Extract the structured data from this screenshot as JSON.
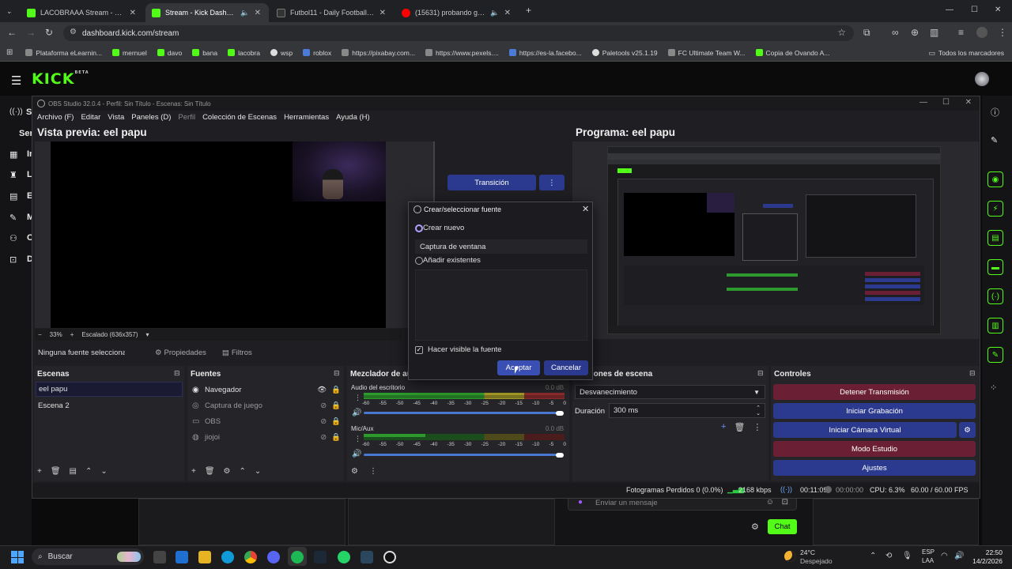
{
  "browser": {
    "tabs": [
      {
        "title": "LACOBRAAA Stream - Watch Live",
        "active": false,
        "favicon": "kick"
      },
      {
        "title": "Stream - Kick Dashboard",
        "active": true,
        "favicon": "kick"
      },
      {
        "title": "Futbol11 - Daily Football Games",
        "active": false,
        "favicon": "futbol11"
      },
      {
        "title": "(15631) probando gaseosas",
        "active": false,
        "favicon": "youtube"
      }
    ],
    "url": "dashboard.kick.com/stream",
    "bookmarks": [
      {
        "label": "Plataforma eLearnin..."
      },
      {
        "label": "mernuel"
      },
      {
        "label": "davo"
      },
      {
        "label": "bana"
      },
      {
        "label": "lacobra"
      },
      {
        "label": "wsp"
      },
      {
        "label": "roblox"
      },
      {
        "label": "https://pixabay.com..."
      },
      {
        "label": "https://www.pexels...."
      },
      {
        "label": "https://es-la.facebo..."
      },
      {
        "label": "Paletools v25.1.19"
      },
      {
        "label": "FC Ultimate Team W..."
      },
      {
        "label": "Copia de Ovando A..."
      }
    ],
    "bookmarks_folder": "Todos los marcadores"
  },
  "kick": {
    "logo": "KICK",
    "beta": "BETA",
    "side_letters": [
      "S",
      "Ser",
      "In",
      "L",
      "E",
      "M",
      "C",
      "D"
    ],
    "chat_placeholder": "Enviar un mensaje",
    "chat_button": "Chat"
  },
  "obs": {
    "title": "OBS Studio 32.0.4 - Perfil: Sin Título - Escenas: Sin Título",
    "menu": [
      "Archivo (F)",
      "Editar",
      "Vista",
      "Paneles (D)",
      "Perfil",
      "Colección de Escenas",
      "Herramientas",
      "Ayuda (H)"
    ],
    "preview_title": "Vista previa: eel papu",
    "program_title": "Programa: eel papu",
    "transition_button": "Transición",
    "zoom": "33%",
    "scaling": "Escalado (636x357)",
    "no_source": "Ninguna fuente seleccionad",
    "properties": "Propiedades",
    "filters": "Filtros",
    "scenes_header": "Escenas",
    "scenes": [
      "eel papu",
      "Escena 2"
    ],
    "sources_header": "Fuentes",
    "sources": [
      {
        "name": "Navegador",
        "visible": true
      },
      {
        "name": "Captura de juego",
        "visible": false
      },
      {
        "name": "OBS",
        "visible": false
      },
      {
        "name": "jiojoi",
        "visible": false
      }
    ],
    "mixer_header": "Mezclador de aud",
    "mixer": [
      {
        "name": "Audio del escritorio",
        "db": "0.0 dB"
      },
      {
        "name": "Mic/Aux",
        "db": "0.0 dB"
      }
    ],
    "meter_ticks": [
      "-60",
      "-55",
      "-50",
      "-45",
      "-40",
      "-35",
      "-30",
      "-25",
      "-20",
      "-15",
      "-10",
      "-5",
      "0"
    ],
    "transitions_header": "siciones de escena",
    "transition_type": "Desvanecimiento",
    "duration_label": "Duración",
    "duration_value": "300 ms",
    "controls_header": "Controles",
    "controls": [
      {
        "label": "Detener Transmisión",
        "style": "red"
      },
      {
        "label": "Iniciar Grabación",
        "style": "blue"
      },
      {
        "label": "Iniciar Cámara Virtual",
        "style": "blue"
      },
      {
        "label": "Modo Estudio",
        "style": "red"
      },
      {
        "label": "Ajustes",
        "style": "blue"
      }
    ],
    "status": {
      "dropped": "Fotogramas Perdidos 0 (0.0%)",
      "bitrate": "2168 kbps",
      "stream_time": "00:11:09",
      "rec_time": "00:00:00",
      "cpu": "CPU: 6.3%",
      "fps": "60.00 / 60.00 FPS"
    }
  },
  "dialog": {
    "title": "Crear/seleccionar fuente",
    "create_new": "Crear nuevo",
    "name_value": "Captura de ventana",
    "add_existing": "Añadir existentes",
    "visible_check": "Hacer visible la fuente",
    "accept": "Aceptar",
    "cancel": "Cancelar"
  },
  "taskbar": {
    "search": "Buscar",
    "weather_temp": "24°C",
    "weather_desc": "Despejado",
    "lang1": "ESP",
    "lang2": "LAA",
    "time": "22:50",
    "date": "14/2/2026"
  },
  "colors": {
    "kick_green": "#53fc18",
    "obs_blue": "#2b3a8f",
    "obs_red": "#6a1f35"
  }
}
